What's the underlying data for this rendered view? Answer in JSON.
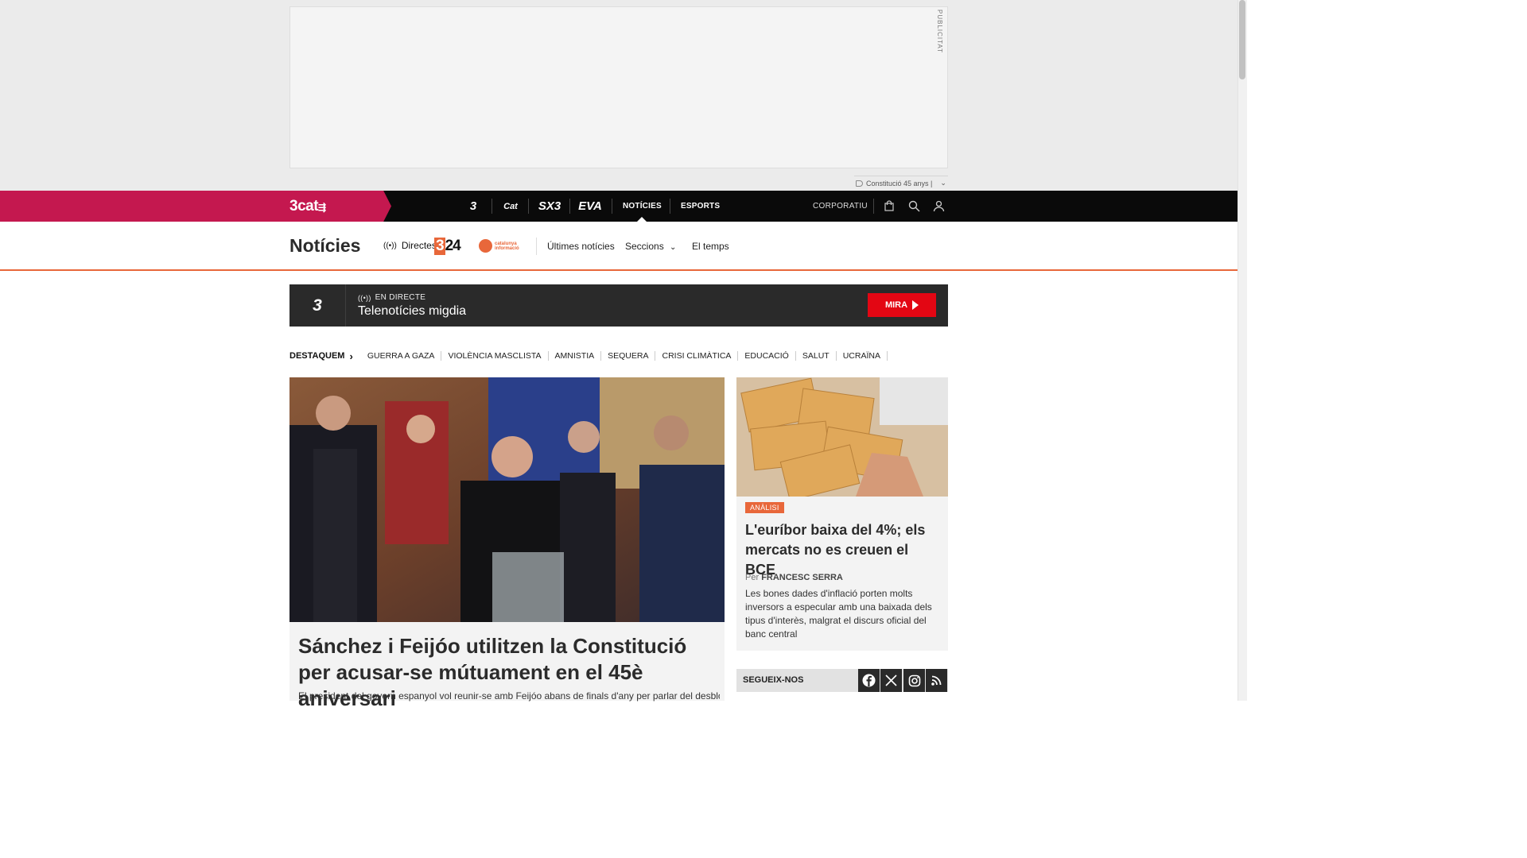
{
  "ad": {
    "label": "PUBLICITAT",
    "tag": "Constitució 45 anys |"
  },
  "topnav": {
    "logo": "3cat",
    "channels": [
      "3",
      "Cat",
      "SX3",
      "EVA"
    ],
    "links": [
      {
        "label": "NOTÍCIES",
        "active": true
      },
      {
        "label": "ESPORTS",
        "active": false
      }
    ],
    "corporate": "CORPORATIU",
    "icons": [
      "shopping-bag-icon",
      "search-icon",
      "user-icon"
    ]
  },
  "section": {
    "title": "Notícies",
    "live_label": "Directes",
    "logo324": "324",
    "logo_catinfo": "catalunya informació",
    "links": [
      "Últimes notícies",
      "Seccions",
      "El temps"
    ]
  },
  "live": {
    "channel": "3",
    "status": "EN DIRECTE",
    "program": "Telenotícies migdia",
    "button": "MIRA"
  },
  "topics": {
    "lead": "DESTAQUEM",
    "items": [
      "GUERRA A GAZA",
      "VIOLÈNCIA MASCLISTA",
      "AMNISTIA",
      "SEQUERA",
      "CRISI CLIMÀTICA",
      "EDUCACIÓ",
      "SALUT",
      "UCRAÏNA"
    ]
  },
  "main_article": {
    "title": "Sánchez i Feijóo utilitzen la Constitució per acusar-se mútuament en el 45è aniversari",
    "description": "El president del govern espanyol vol reunir-se amb Feijóo abans de finals d'any per parlar del desbloqueig"
  },
  "side_article": {
    "tag": "ANÀLISI",
    "title": "L'euríbor baixa del 4%; els mercats no es creuen el BCE",
    "byline_prefix": "Per",
    "author": "FRANCESC SERRA",
    "description": "Les bones dades d'inflació porten molts inversors a especular amb una baixada dels tipus d'interès, malgrat el discurs oficial del banc central"
  },
  "social": {
    "label": "SEGUEIX-NOS",
    "icons": [
      "facebook-icon",
      "x-icon",
      "instagram-icon",
      "rss-icon"
    ]
  },
  "colors": {
    "brand_pink": "#c4184f",
    "accent_orange": "#e8673a",
    "live_red": "#e30613"
  }
}
